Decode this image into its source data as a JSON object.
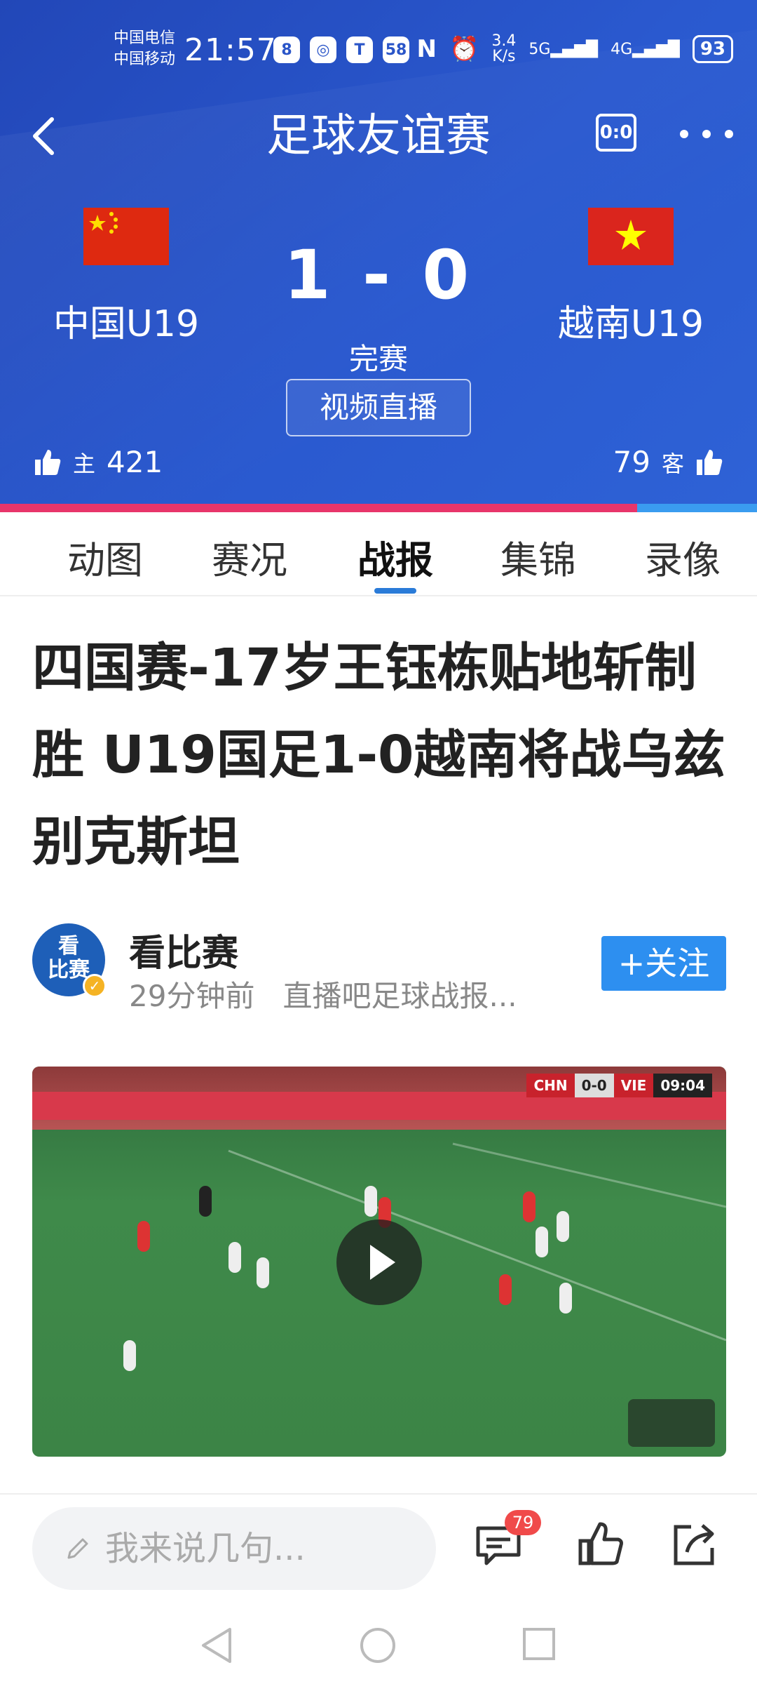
{
  "status_bar": {
    "carrier_1": "中国电信",
    "carrier_2": "中国移动",
    "time": "21:57",
    "app_icons": [
      "8",
      "◎",
      "T",
      "58"
    ],
    "speed_top": "3.4",
    "speed_bottom": "K/s",
    "net_1": "5G",
    "net_2": "4G",
    "battery": "93"
  },
  "nav": {
    "title": "足球友谊赛",
    "score_icon_text": "0:0"
  },
  "match": {
    "home_team": "中国U19",
    "away_team": "越南U19",
    "score": "1 - 0",
    "status": "完赛",
    "live_button": "视频直播",
    "home_label": "主",
    "home_votes": "421",
    "away_label": "客",
    "away_votes": "79",
    "home_vote_share": 0.842
  },
  "tabs": [
    "动图",
    "赛况",
    "战报",
    "集锦",
    "录像"
  ],
  "active_tab": "战报",
  "article": {
    "headline": "四国赛-17岁王钰栋贴地斩制胜 U19国足1-0越南将战乌兹别克斯坦",
    "author": "看比赛",
    "avatar_text_1": "看",
    "avatar_text_2": "比赛",
    "time_ago": "29分钟前",
    "source": "直播吧足球战报...",
    "follow_label": "+关注"
  },
  "video": {
    "scoreboard_home": "CHN",
    "scoreboard_score": "0-0",
    "scoreboard_away": "VIE",
    "scoreboard_time": "09:04"
  },
  "bottom_bar": {
    "comment_placeholder": "我来说几句...",
    "comment_count": "79"
  },
  "colors": {
    "header_blue": "#2a55c8",
    "accent_blue": "#2d8ff0",
    "home_bar": "#e8356a",
    "away_bar": "#3a9cf0"
  }
}
